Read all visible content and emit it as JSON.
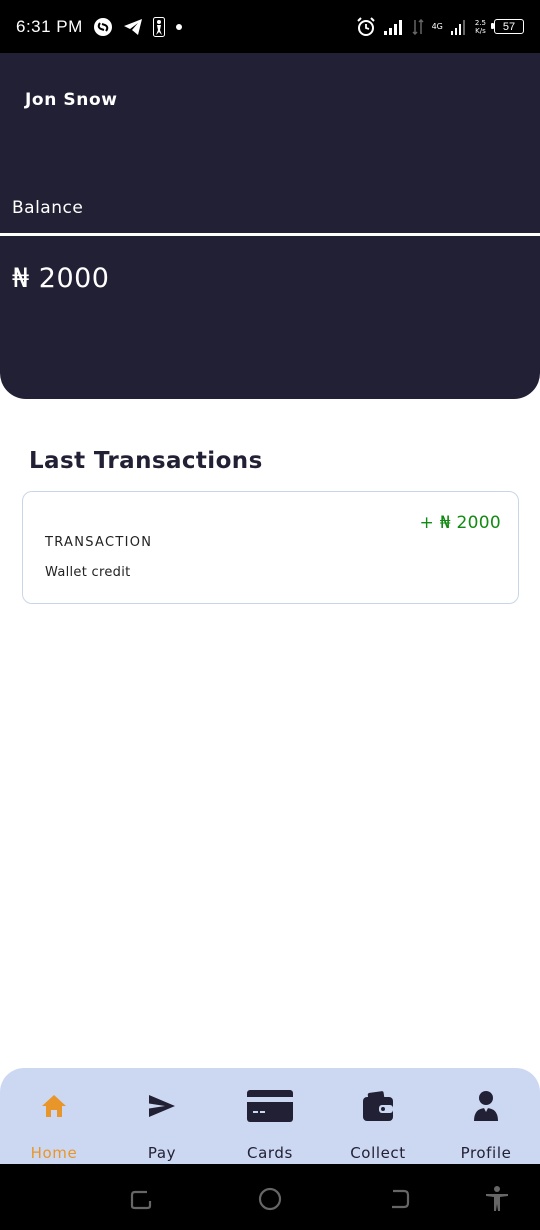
{
  "status_bar": {
    "time": "6:31 PM",
    "network_type": "4G",
    "speed_value": "2.5",
    "speed_unit": "K/s",
    "battery": "57",
    "icons": [
      "shazam-icon",
      "telegram-icon",
      "nba-icon",
      "dot-icon",
      "alarm-icon",
      "signal-icon",
      "data-icon",
      "signal-2-icon"
    ]
  },
  "header": {
    "user_name": "Jon Snow",
    "balance_label": "Balance",
    "balance_value": "₦ 2000",
    "background_color": "#222034"
  },
  "transactions": {
    "title": "Last Transactions",
    "items": [
      {
        "amount": "+ ₦ 2000",
        "type": "TRANSACTION",
        "description": "Wallet credit",
        "amount_color": "#128b12"
      }
    ]
  },
  "bottom_nav": {
    "items": [
      {
        "label": "Home",
        "icon": "home-icon",
        "active": true
      },
      {
        "label": "Pay",
        "icon": "send-icon",
        "active": false
      },
      {
        "label": "Cards",
        "icon": "card-icon",
        "active": false
      },
      {
        "label": "Collect",
        "icon": "wallet-icon",
        "active": false
      },
      {
        "label": "Profile",
        "icon": "profile-icon",
        "active": false
      }
    ],
    "active_color": "#e8962a",
    "background_color": "#ccd8f2"
  },
  "system_nav": {
    "icons": [
      "recents-icon",
      "home-circle-icon",
      "back-icon",
      "accessibility-icon"
    ]
  }
}
